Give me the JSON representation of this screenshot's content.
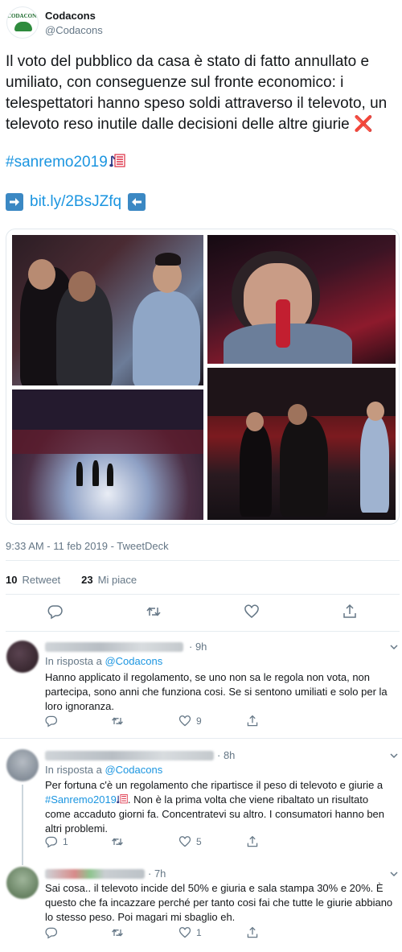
{
  "author": {
    "name": "Codacons",
    "handle": "@Codacons",
    "logo_text": "CODACONS"
  },
  "tweet": {
    "text": "Il voto del pubblico da casa è stato di fatto annullato e umiliato, con conseguenze sul fronte economico: i telespettatori hanno speso soldi attraverso il televoto, un televoto reso inutile dalle decisioni delle altre giurie",
    "x_emoji": "❌",
    "hashtag": "#sanremo2019",
    "link": "bit.ly/2BsJZfq",
    "timestamp": "9:33 AM - 11 feb 2019 - TweetDeck"
  },
  "stats": {
    "retweets_count": "10",
    "retweets_label": "Retweet",
    "likes_count": "23",
    "likes_label": "Mi piace"
  },
  "icons": {
    "reply": "reply-icon",
    "retweet": "retweet-icon",
    "like": "heart-icon",
    "share": "share-icon",
    "menu": "chevron-down-icon"
  },
  "replies": [
    {
      "time": "· 9h",
      "in_reply_prefix": "In risposta a",
      "mention": "@Codacons",
      "body": "Hanno applicato il regolamento, se uno non sa le regola non vota, non partecipa, sono anni che funziona cosi. Se si sentono umiliati e solo per la loro ignoranza.",
      "replies": "",
      "retweets": "",
      "likes": "9"
    },
    {
      "time": "· 8h",
      "in_reply_prefix": "In risposta a",
      "mention": "@Codacons",
      "body_1": "Per fortuna c'è un regolamento che ripartisce il peso di televoto e giurie a",
      "hashtag": "#Sanremo2019",
      "body_2": ". Non è la prima volta che viene ribaltato un risultato come accaduto giorni fa. Concentratevi su altro. I consumatori hanno ben altri problemi.",
      "replies": "1",
      "retweets": "",
      "likes": "5"
    },
    {
      "time": "· 7h",
      "body": "Sai cosa.. il televoto incide del 50% e giuria e sala stampa 30% e 20%. È questo che fa incazzare perché per tanto cosi fai che tutte le giurie abbiano lo stesso peso. Poi magari mi sbaglio eh.",
      "replies": "",
      "retweets": "",
      "likes": "1"
    }
  ],
  "colors": {
    "link": "#1b95e0",
    "muted": "#657786",
    "text": "#14171a",
    "divider": "#e6ecf0"
  }
}
